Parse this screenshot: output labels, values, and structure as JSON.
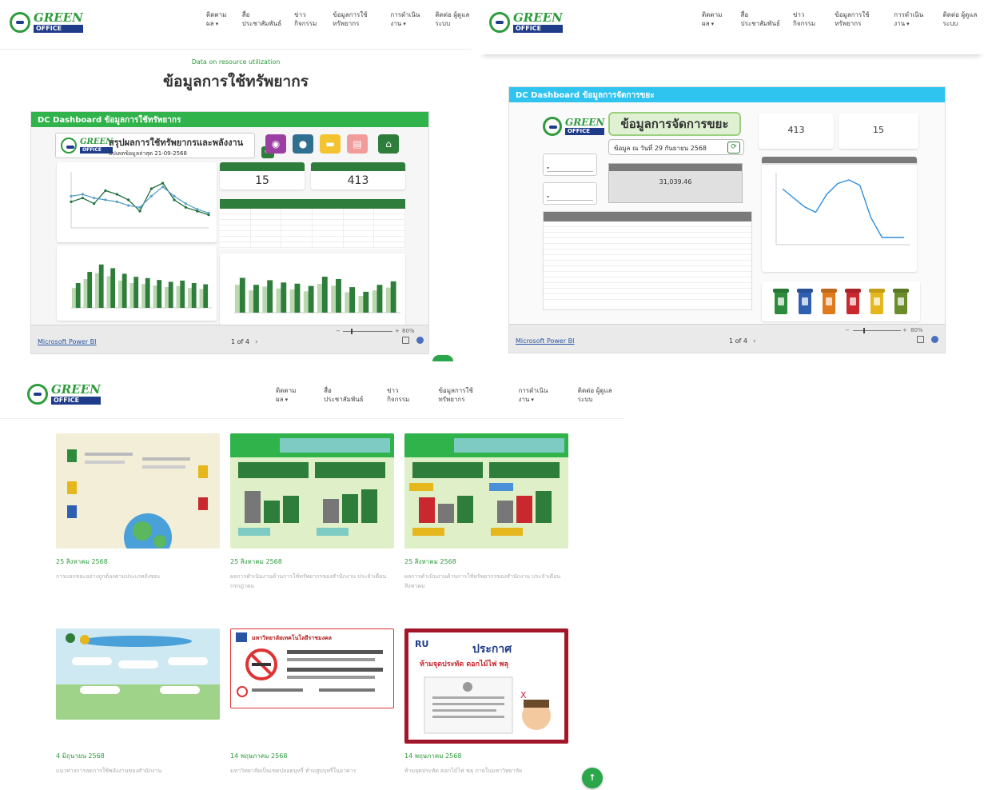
{
  "brand": {
    "logo_top": "GREEN",
    "logo_bottom": "OFFICE"
  },
  "nav": {
    "items": [
      {
        "label": "ติดตามผล",
        "caret": "▾"
      },
      {
        "label": "สื่อ ประชาสัมพันธ์"
      },
      {
        "label": "ข่าว กิจกรรม"
      },
      {
        "label": "ข้อมูลการใช้ ทรัพยากร"
      },
      {
        "label": "การดำเนินงาน",
        "caret": "▾"
      },
      {
        "label": "ติดต่อ ผู้ดูแล ระบบ"
      }
    ]
  },
  "resource_page": {
    "kicker": "Data on resource utilization",
    "title": "ข้อมูลการใช้ทรัพยากร"
  },
  "resource_dashboard": {
    "header": "DC Dashboard ข้อมูลการใช้ทรัพยากร",
    "header_color": "#2fb34a",
    "report_title": "สรุปผลการใช้ทรัพยากรและพลังงาน",
    "report_date": "อัปเดตข้อมูลล่าสุด 21-09-2568",
    "kpis": [
      {
        "value": "15"
      },
      {
        "value": "413"
      }
    ],
    "footer_link": "Microsoft Power BI",
    "pager": "1 of 4",
    "zoom": "80%",
    "icons": [
      {
        "name": "bulb",
        "color": "#9b3fa3",
        "glyph": "◉"
      },
      {
        "name": "water",
        "color": "#2f6f8f",
        "glyph": "●"
      },
      {
        "name": "fuel",
        "color": "#f4c430",
        "glyph": "▬"
      },
      {
        "name": "paper",
        "color": "#f19b9b",
        "glyph": "▤"
      },
      {
        "name": "home",
        "color": "#2e7d3a",
        "glyph": "⌂"
      }
    ],
    "line_chart": {
      "series_a": [
        58,
        62,
        56,
        70,
        66,
        60,
        48,
        72,
        78,
        60,
        52,
        48,
        44
      ],
      "series_b": [
        64,
        66,
        62,
        60,
        58,
        54,
        52,
        64,
        74,
        64,
        56,
        50,
        46
      ]
    },
    "bar_chart_left": {
      "values": [
        40,
        58,
        70,
        64,
        55,
        50,
        48,
        45,
        42,
        44,
        40,
        38
      ]
    },
    "bar_chart_right": {
      "values": [
        60,
        48,
        56,
        52,
        50,
        46,
        62,
        58,
        44,
        36,
        48,
        54
      ]
    }
  },
  "waste_dashboard": {
    "header": "DC Dashboard ข้อมูลการจัดการขยะ",
    "header_color": "#2fc3f0",
    "title": "ข้อมูลการจัดการขยะ",
    "date": "ข้อมูล ณ วันที่ 29 กันยายน 2568",
    "kpis": [
      {
        "value": "413"
      },
      {
        "value": "15"
      }
    ],
    "total": "31,039.46",
    "footer_link": "Microsoft Power BI",
    "pager": "1 of 4",
    "zoom": "80%",
    "line": [
      62,
      52,
      42,
      36,
      56,
      68,
      72,
      66,
      30,
      8,
      8,
      8
    ],
    "bins": [
      "#2e8b3c",
      "#2f5fb0",
      "#e07a1f",
      "#c8282e",
      "#e6b71c",
      "#6a8c2a"
    ]
  },
  "posts": [
    {
      "date": "25 สิงหาคม 2568",
      "desc": "การแยกขยะอย่างถูกต้องตามประเภทถังขยะ",
      "bg": "#f2eed8"
    },
    {
      "date": "25 สิงหาคม 2568",
      "desc": "ผลการดำเนินงานด้านการใช้ทรัพยากรของสำนักงาน ประจำเดือนกรกฎาคม",
      "bg": "#dff0c9"
    },
    {
      "date": "25 สิงหาคม 2568",
      "desc": "ผลการดำเนินงานด้านการใช้ทรัพยากรของสำนักงาน ประจำเดือนสิงหาคม",
      "bg": "#dff0c9"
    },
    {
      "date": "4 มิถุนายน 2568",
      "desc": "แนวทางการลดการใช้พลังงานของสำนักงาน",
      "bg": "#cfe9f3"
    },
    {
      "date": "14 พฤษภาคม 2568",
      "desc": "มหาวิทยาลัยเป็นเขตปลอดบุหรี่ ห้ามสูบบุหรี่ในอาคาร",
      "bg": "#fff"
    },
    {
      "date": "14 พฤษภาคม 2568",
      "desc": "ห้ามจุดประทัด ดอกไม้ไฟ พลุ ภายในมหาวิทยาลัย",
      "bg": "#fff"
    }
  ],
  "poster_texts": {
    "no_smoking_line": "มหาวิทยาลัยเทคโนโลยีราชมงคล",
    "notice_title": "ประกาศ",
    "notice_line": "ห้ามจุดประทัด ดอกไม้ไฟ พลุ"
  },
  "fab_label": "↑"
}
